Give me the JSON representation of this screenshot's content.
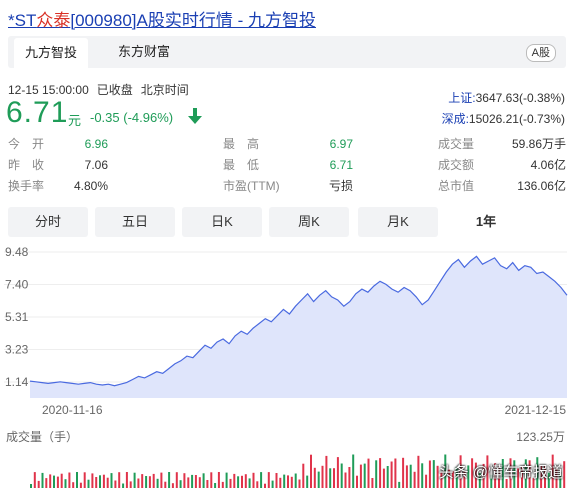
{
  "title": {
    "prefix": "*ST",
    "name": "众泰",
    "code": "[000980]",
    "suffix": "A股实时行情 - 九方智投"
  },
  "tabs": [
    {
      "label": "九方智投"
    },
    {
      "label": "东方财富"
    }
  ],
  "badge": "A股",
  "status": {
    "datetime": "12-15 15:00:00",
    "state": "已收盘",
    "tz": "北京时间"
  },
  "quote": {
    "price": "6.71",
    "unit": "元",
    "change": "-0.35 (-4.96%)"
  },
  "indices": [
    {
      "name": "上证:",
      "value": "3647.63(-0.38%)"
    },
    {
      "name": "深成:",
      "value": "15026.21(-0.73%)"
    }
  ],
  "stats": [
    [
      {
        "label": "今　开",
        "value": "6.96",
        "green": true
      },
      {
        "label": "最　高",
        "value": "6.97",
        "green": true
      },
      {
        "label": "成交量",
        "value": "59.86万手",
        "green": false
      }
    ],
    [
      {
        "label": "昨　收",
        "value": "7.06",
        "green": false
      },
      {
        "label": "最　低",
        "value": "6.71",
        "green": true
      },
      {
        "label": "成交额",
        "value": "4.06亿",
        "green": false
      }
    ],
    [
      {
        "label": "换手率",
        "value": "4.80%",
        "green": false
      },
      {
        "label": "市盈(TTM)",
        "value": "亏损",
        "green": false
      },
      {
        "label": "总市值",
        "value": "136.06亿",
        "green": false
      }
    ]
  ],
  "periods": [
    "分时",
    "五日",
    "日K",
    "周K",
    "月K",
    "1年"
  ],
  "active_period": "1年",
  "colors": {
    "accent_green": "#1f9c58",
    "link_blue": "#1a3fb3",
    "up_red": "#e0334a"
  },
  "chart_data": {
    "type": "area",
    "y_ticks": [
      "9.48",
      "7.40",
      "5.31",
      "3.23",
      "1.14"
    ],
    "x_labels": [
      "2020-11-16",
      "2021-12-15"
    ],
    "ylim": [
      1.14,
      9.48
    ],
    "values": [
      1.2,
      1.15,
      1.1,
      1.05,
      1.1,
      1.15,
      1.1,
      1.05,
      1.0,
      1.05,
      1.1,
      1.0,
      0.95,
      1.0,
      0.9,
      1.0,
      1.1,
      1.3,
      1.5,
      1.4,
      1.6,
      1.8,
      1.7,
      2.0,
      2.3,
      2.5,
      2.8,
      2.7,
      3.1,
      3.5,
      3.3,
      3.7,
      3.9,
      3.6,
      4.1,
      4.4,
      4.2,
      4.6,
      4.9,
      5.2,
      5.0,
      5.4,
      5.8,
      5.5,
      6.0,
      6.4,
      6.8,
      6.3,
      6.7,
      7.0,
      6.6,
      6.4,
      6.0,
      6.3,
      6.8,
      7.1,
      6.9,
      7.3,
      7.6,
      7.4,
      7.1,
      6.9,
      7.2,
      7.0,
      6.6,
      6.1,
      6.4,
      7.0,
      7.6,
      8.2,
      8.7,
      9.0,
      8.5,
      8.9,
      9.2,
      8.7,
      8.9,
      9.1,
      8.6,
      8.4,
      8.8,
      8.3,
      8.6,
      8.5,
      8.1,
      8.2,
      7.9,
      7.6,
      7.2,
      6.7
    ],
    "volume_label": "成交量（手）",
    "volume_max": "123.25万"
  },
  "watermark": "头条 @懂车帝报道"
}
